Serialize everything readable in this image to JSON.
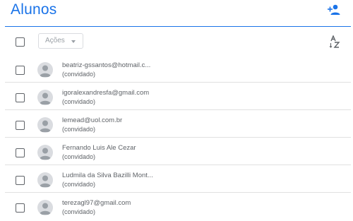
{
  "header": {
    "title": "Alunos",
    "invite_icon": "person-add-icon",
    "accent_color": "#1a73e8"
  },
  "toolbar": {
    "actions_label": "Ações",
    "sort_icon": "sort-az-icon"
  },
  "students": [
    {
      "name": "beatriz-gssantos@hotmail.c...",
      "status": "(convidado)"
    },
    {
      "name": "igoralexandresfa@gmail.com",
      "status": "(convidado)"
    },
    {
      "name": "lemead@uol.com.br",
      "status": "(convidado)"
    },
    {
      "name": "Fernando Luis Ale Cezar",
      "status": "(convidado)"
    },
    {
      "name": "Ludmila da Silva Bazilli Mont...",
      "status": "(convidado)"
    },
    {
      "name": "terezagl97@gmail.com",
      "status": "(convidado)"
    }
  ]
}
